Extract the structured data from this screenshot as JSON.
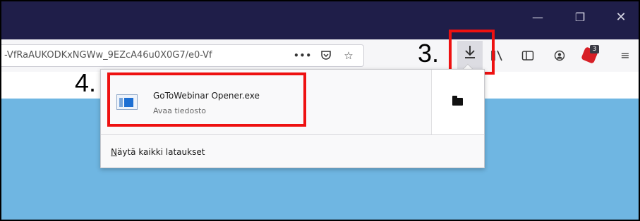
{
  "window": {
    "minimize_glyph": "—",
    "restore_glyph": "❐",
    "close_glyph": "✕"
  },
  "navbar": {
    "url_text": "-VfRaAUKODKxNGWw_9EZcA46u0X0G7/e0-Vf",
    "more_glyph": "•••",
    "icons": [
      "page-actions-more-icon",
      "pocket-icon",
      "bookmark-star-icon",
      "downloads-icon",
      "library-icon",
      "sidebar-icon",
      "account-icon",
      "adblock-plus-icon",
      "hamburger-menu-icon"
    ],
    "abp_badge": "3"
  },
  "annotations": {
    "step3": "3.",
    "step4": "4.",
    "highlight_color": "#ee1111"
  },
  "downloads_panel": {
    "item": {
      "filename": "GoToWebinar Opener.exe",
      "status": "Avaa tiedosto"
    },
    "show_all_first_letter": "N",
    "show_all_rest": "äytä kaikki lataukset"
  },
  "colors": {
    "titlebar": "#1f1e49",
    "page_background": "#6fb6e2",
    "abp_red": "#d71f26"
  }
}
